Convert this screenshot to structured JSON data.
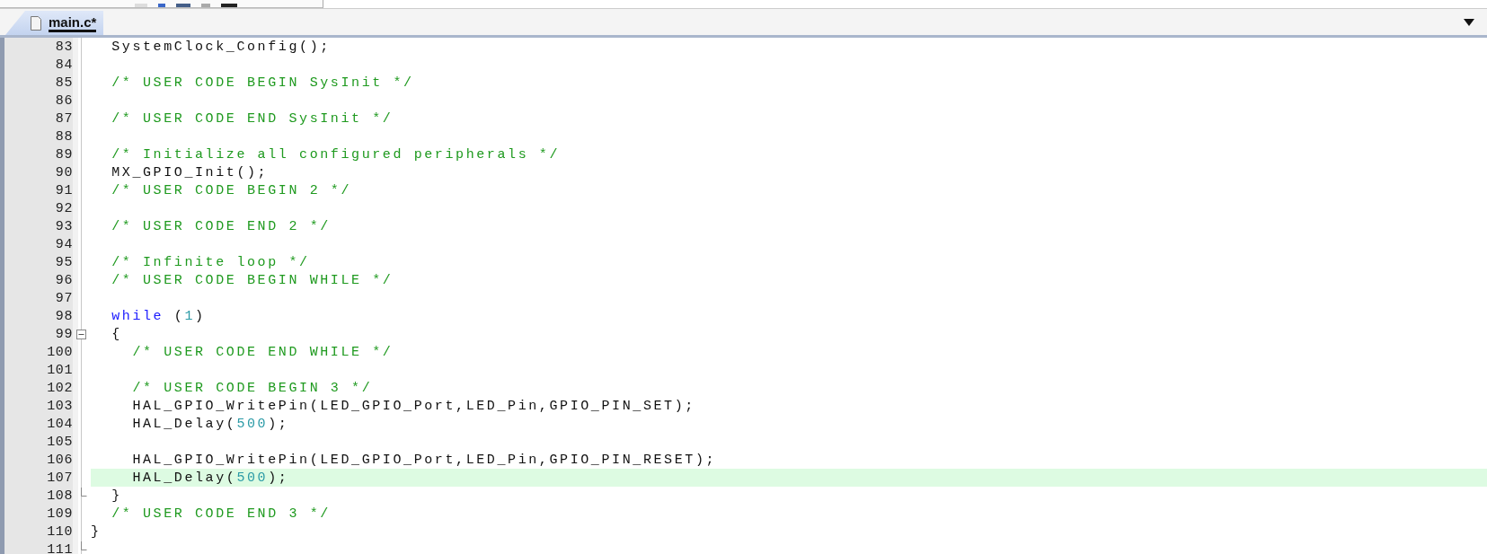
{
  "tabs": [
    {
      "label": "main.c*",
      "selected": true
    }
  ],
  "lines": [
    {
      "number": "83",
      "highlighted": false,
      "kind": "plain",
      "tokens": [
        {
          "kind": "plain",
          "text": "  SystemClock_Config();"
        }
      ]
    },
    {
      "number": "84",
      "highlighted": false,
      "kind": "plain"
    },
    {
      "number": "85",
      "highlighted": false,
      "kind": "plain",
      "tokens": [
        {
          "kind": "comment",
          "text": "  /* USER CODE BEGIN SysInit */"
        }
      ]
    },
    {
      "number": "86",
      "highlighted": false,
      "kind": "plain"
    },
    {
      "number": "87",
      "highlighted": false,
      "kind": "plain",
      "tokens": [
        {
          "kind": "comment",
          "text": "  /* USER CODE END SysInit */"
        }
      ]
    },
    {
      "number": "88",
      "highlighted": false,
      "kind": "plain"
    },
    {
      "number": "89",
      "highlighted": false,
      "kind": "plain",
      "tokens": [
        {
          "kind": "comment",
          "text": "  /* Initialize all configured peripherals */"
        }
      ]
    },
    {
      "number": "90",
      "highlighted": false,
      "kind": "plain",
      "tokens": [
        {
          "kind": "plain",
          "text": "  MX_GPIO_Init();"
        }
      ]
    },
    {
      "number": "91",
      "highlighted": false,
      "kind": "plain",
      "tokens": [
        {
          "kind": "comment",
          "text": "  /* USER CODE BEGIN 2 */"
        }
      ]
    },
    {
      "number": "92",
      "highlighted": false,
      "kind": "plain"
    },
    {
      "number": "93",
      "highlighted": false,
      "kind": "plain",
      "tokens": [
        {
          "kind": "comment",
          "text": "  /* USER CODE END 2 */"
        }
      ]
    },
    {
      "number": "94",
      "highlighted": false,
      "kind": "plain"
    },
    {
      "number": "95",
      "highlighted": false,
      "kind": "plain",
      "tokens": [
        {
          "kind": "comment",
          "text": "  /* Infinite loop */"
        }
      ]
    },
    {
      "number": "96",
      "highlighted": false,
      "kind": "plain",
      "tokens": [
        {
          "kind": "comment",
          "text": "  /* USER CODE BEGIN WHILE */"
        }
      ]
    },
    {
      "number": "97",
      "highlighted": false,
      "kind": "plain"
    },
    {
      "number": "98",
      "highlighted": false,
      "kind": "plain",
      "tokens": [
        {
          "kind": "keyword",
          "text": "  while"
        },
        {
          "kind": "plain",
          "text": " ("
        },
        {
          "kind": "number",
          "text": "1"
        },
        {
          "kind": "plain",
          "text": ")"
        }
      ]
    },
    {
      "number": "99",
      "highlighted": false,
      "kind": "foldstart",
      "tokens": [
        {
          "kind": "plain",
          "text": "  {"
        }
      ]
    },
    {
      "number": "100",
      "highlighted": false,
      "kind": "plain",
      "tokens": [
        {
          "kind": "comment",
          "text": "    /* USER CODE END WHILE */"
        }
      ]
    },
    {
      "number": "101",
      "highlighted": false,
      "kind": "plain"
    },
    {
      "number": "102",
      "highlighted": false,
      "kind": "plain",
      "tokens": [
        {
          "kind": "comment",
          "text": "    /* USER CODE BEGIN 3 */"
        }
      ]
    },
    {
      "number": "103",
      "highlighted": false,
      "kind": "plain",
      "tokens": [
        {
          "kind": "plain",
          "text": "    HAL_GPIO_WritePin(LED_GPIO_Port,LED_Pin,GPIO_PIN_SET);"
        }
      ]
    },
    {
      "number": "104",
      "highlighted": false,
      "kind": "plain",
      "tokens": [
        {
          "kind": "plain",
          "text": "    HAL_Delay("
        },
        {
          "kind": "number",
          "text": "500"
        },
        {
          "kind": "plain",
          "text": ");"
        }
      ]
    },
    {
      "number": "105",
      "highlighted": false,
      "kind": "plain"
    },
    {
      "number": "106",
      "highlighted": false,
      "kind": "plain",
      "tokens": [
        {
          "kind": "plain",
          "text": "    HAL_GPIO_WritePin(LED_GPIO_Port,LED_Pin,GPIO_PIN_RESET);"
        }
      ]
    },
    {
      "number": "107",
      "highlighted": true,
      "kind": "plain",
      "tokens": [
        {
          "kind": "plain",
          "text": "    HAL_Delay("
        },
        {
          "kind": "number",
          "text": "500"
        },
        {
          "kind": "plain",
          "text": ");"
        }
      ]
    },
    {
      "number": "108",
      "highlighted": false,
      "kind": "foldend",
      "tokens": [
        {
          "kind": "plain",
          "text": "  }"
        }
      ]
    },
    {
      "number": "109",
      "highlighted": false,
      "kind": "plain",
      "tokens": [
        {
          "kind": "comment",
          "text": "  /* USER CODE END 3 */"
        }
      ]
    },
    {
      "number": "110",
      "highlighted": false,
      "kind": "plain",
      "tokens": [
        {
          "kind": "plain",
          "text": "}"
        }
      ]
    },
    {
      "number": "111",
      "highlighted": false,
      "kind": "foldend"
    }
  ]
}
